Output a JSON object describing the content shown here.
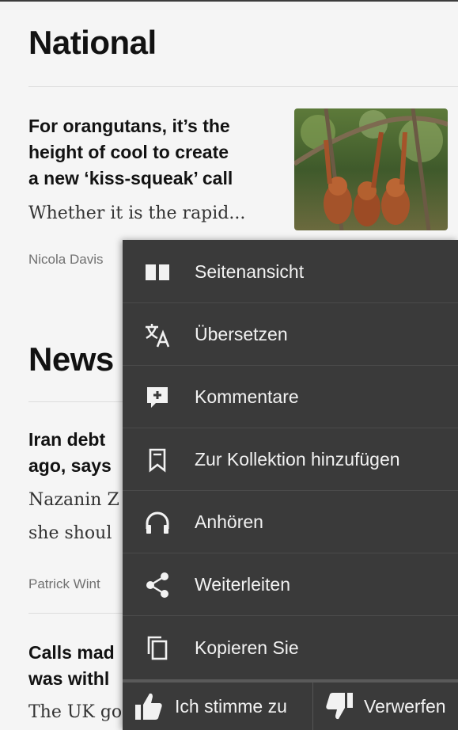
{
  "feed": {
    "section1_title": "National",
    "article1": {
      "headline_lines": [
        "For orangutans, it’s the",
        "height of cool to create",
        "a new ‘kiss-squeak’ call"
      ],
      "standfirst": "Whether it is the rapid...",
      "byline": "Nicola Davis"
    },
    "section2_title": "News",
    "article2": {
      "headline_lines": [
        "Iran debt",
        "ago, says"
      ],
      "standfirst_lines": [
        "Nazanin Z",
        "she shoul"
      ],
      "byline": "Patrick Wint"
    },
    "article3": {
      "headline_lines": [
        "Calls mad",
        "was withl"
      ],
      "standfirst": "The UK go"
    }
  },
  "menu": {
    "items": [
      {
        "label": "Seitenansicht",
        "icon": "split-view-icon"
      },
      {
        "label": "Übersetzen",
        "icon": "translate-icon"
      },
      {
        "label": "Kommentare",
        "icon": "comment-icon"
      },
      {
        "label": "Zur Kollektion hinzufügen",
        "icon": "bookmark-icon"
      },
      {
        "label": "Anhören",
        "icon": "headphones-icon"
      },
      {
        "label": "Weiterleiten",
        "icon": "share-icon"
      },
      {
        "label": "Kopieren Sie",
        "icon": "copy-icon"
      }
    ],
    "footer": {
      "agree_label": "Ich stimme zu",
      "dismiss_label": "Verwerfen"
    }
  }
}
